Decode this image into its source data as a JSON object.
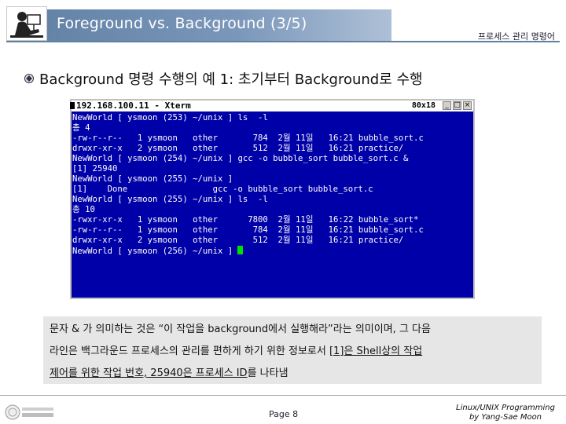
{
  "header": {
    "title": "Foreground vs. Background (3/5)",
    "right_label": "프로세스 관리 명령어"
  },
  "heading": "Background 명령 수행의 예 1: 초기부터 Background로 수행",
  "terminal": {
    "title": "192.168.100.11 - Xterm",
    "size": "80x18",
    "buttons": [
      "_",
      "□",
      "×"
    ],
    "lines": [
      "NewWorld [ ysmoon (253) ~/unix ] ls  -l",
      "총 4",
      "-rw-r--r--   1 ysmoon   other       784  2월 11일   16:21 bubble_sort.c",
      "drwxr-xr-x   2 ysmoon   other       512  2월 11일   16:21 practice/",
      "NewWorld [ ysmoon (254) ~/unix ] gcc -o bubble_sort bubble_sort.c &",
      "[1] 25940",
      "NewWorld [ ysmoon (255) ~/unix ]",
      "[1]    Done                 gcc -o bubble_sort bubble_sort.c",
      "NewWorld [ ysmoon (255) ~/unix ] ls  -l",
      "총 10",
      "-rwxr-xr-x   1 ysmoon   other      7800  2월 11일   16:22 bubble_sort*",
      "-rw-r--r--   1 ysmoon   other       784  2월 11일   16:21 bubble_sort.c",
      "drwxr-xr-x   2 ysmoon   other       512  2월 11일   16:21 practice/",
      "NewWorld [ ysmoon (256) ~/unix ] "
    ]
  },
  "description": {
    "line1": "문자 & 가 의미하는 것은 “이 작업을 background에서 실행해라”라는 의미이며, 그 다음",
    "line2_plain": "라인은 백그라운드 프로세스의 관리를 편하게 하기 위한 정보로서 ",
    "line2_underlined": "[1]은 Shell상의 작업",
    "line3_underlined": "제어를 위한 작업 번호, 25940은 프로세스 ID",
    "line3_plain": "를 나타냄"
  },
  "footer": {
    "page": "Page 8",
    "credit_line1": "Linux/UNIX Programming",
    "credit_line2": "by Yang-Sae Moon"
  },
  "colors": {
    "header_blue": "#5f7fa3",
    "terminal_bg": "#0000a8",
    "cursor": "#00e000"
  },
  "icons": [
    "presenter-logo-icon",
    "bullet-icon",
    "university-logo-icon"
  ]
}
